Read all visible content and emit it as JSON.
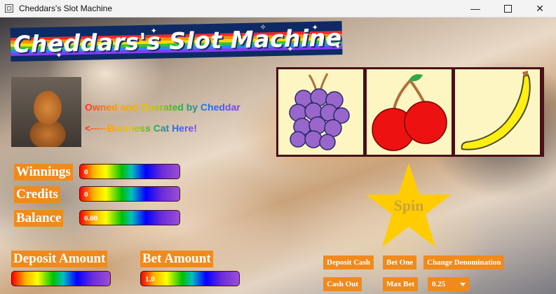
{
  "window": {
    "title": "Cheddars's Slot Machine",
    "minimize": "—",
    "maximize": "",
    "close": "✕"
  },
  "banner": {
    "title": "Cheddars's Slot Machine!"
  },
  "owner": {
    "line1": "Owned and Operated by Cheddar",
    "line2": "<-----Buisness Cat Here!"
  },
  "reels": {
    "symbol1": "grapes-icon",
    "symbol2": "cherries-icon",
    "symbol3": "banana-icon"
  },
  "stats": {
    "winnings_label": "Winnings",
    "winnings_value": "0",
    "credits_label": "Credits",
    "credits_value": "0",
    "balance_label": "Balance",
    "balance_value": "0.00"
  },
  "deposit": {
    "label": "Deposit Amount",
    "value": ""
  },
  "bet": {
    "label": "Bet Amount",
    "value": "1.0"
  },
  "spin": {
    "label": "Spin"
  },
  "buttons": {
    "deposit_cash": "Deposit Cash",
    "bet_one": "Bet One",
    "change_denomination": "Change Denomination",
    "cash_out": "Cash Out",
    "max_bet": "Max Bet"
  },
  "denomination": {
    "selected": "0.25"
  },
  "colors": {
    "accent": "#f08a1c",
    "reel_frame": "#4a0f17",
    "reel_bg": "#fdf6c3",
    "star": "#ffcc00"
  }
}
